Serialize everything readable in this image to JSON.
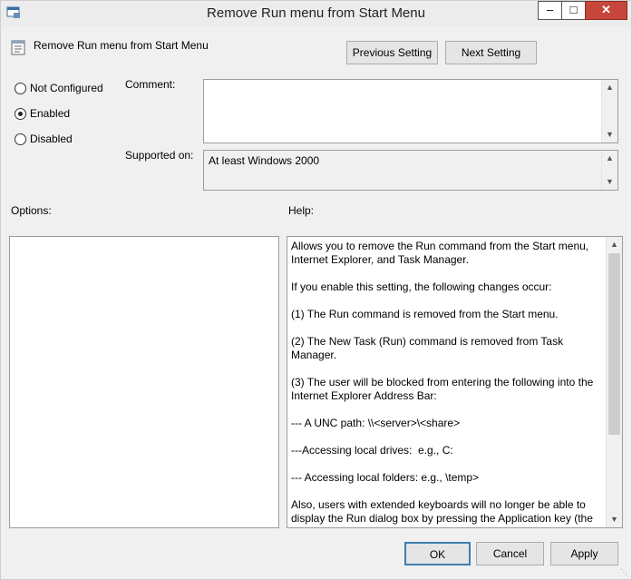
{
  "window": {
    "title": "Remove Run menu from Start Menu"
  },
  "header": {
    "setting_name": "Remove Run menu from Start Menu",
    "prev_label": "Previous Setting",
    "next_label": "Next Setting"
  },
  "state": {
    "options": [
      {
        "label": "Not Configured",
        "selected": false
      },
      {
        "label": "Enabled",
        "selected": true
      },
      {
        "label": "Disabled",
        "selected": false
      }
    ]
  },
  "comment": {
    "label": "Comment:",
    "value": ""
  },
  "supported": {
    "label": "Supported on:",
    "value": "At least Windows 2000"
  },
  "options_pane": {
    "label": "Options:"
  },
  "help_pane": {
    "label": "Help:",
    "paragraphs": [
      "Allows you to remove the Run command from the Start menu, Internet Explorer, and Task Manager.",
      "If you enable this setting, the following changes occur:",
      "(1) The Run command is removed from the Start menu.",
      "(2) The New Task (Run) command is removed from Task Manager.",
      "(3) The user will be blocked from entering the following into the Internet Explorer Address Bar:",
      "--- A UNC path: \\\\<server>\\<share>",
      "---Accessing local drives:  e.g., C:",
      "--- Accessing local folders: e.g., \\temp>",
      "Also, users with extended keyboards will no longer be able to display the Run dialog box by pressing the Application key (the"
    ]
  },
  "footer": {
    "ok_label": "OK",
    "cancel_label": "Cancel",
    "apply_label": "Apply"
  },
  "icons": {
    "app": "policy-app-icon",
    "setting": "policy-setting-icon"
  }
}
